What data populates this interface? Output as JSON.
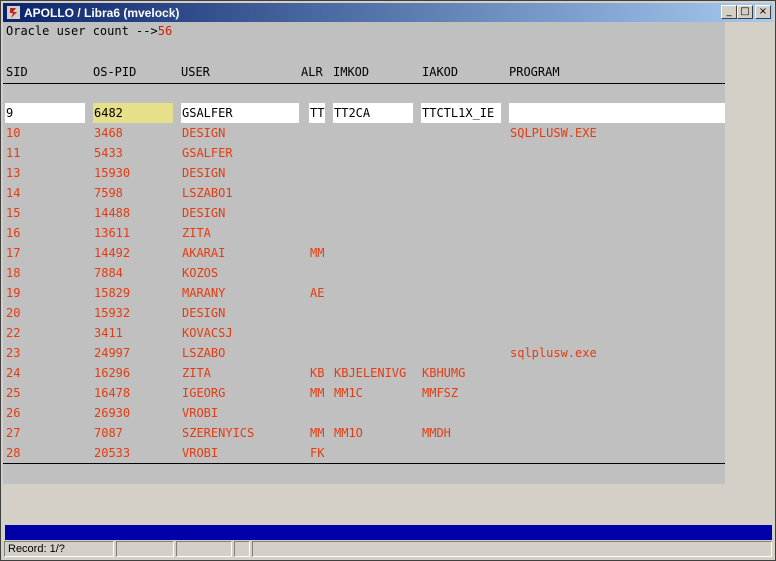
{
  "window": {
    "title": "APOLLO / Libra6 (mvelock)",
    "buttons": {
      "minimize": "_",
      "maximize": "□",
      "close": "×"
    }
  },
  "summary": {
    "label": "Oracle user count -->",
    "value": "56"
  },
  "columns": {
    "sid": "SID",
    "ospid": "OS-PID",
    "user": "USER",
    "alr": "ALR",
    "imkod": "IMKOD",
    "iakod": "IAKOD",
    "program": "PROGRAM"
  },
  "current_row": {
    "sid": "9",
    "ospid": "6482",
    "user": "GSALFER",
    "alr": "TT",
    "imkod": "TT2CA",
    "iakod": "TTCTL1X_IE",
    "program": ""
  },
  "rows": [
    {
      "sid": "10",
      "ospid": "3468",
      "user": "DESIGN",
      "alr": "",
      "imkod": "",
      "iakod": "",
      "program": "SQLPLUSW.EXE"
    },
    {
      "sid": "11",
      "ospid": "5433",
      "user": "GSALFER",
      "alr": "",
      "imkod": "",
      "iakod": "",
      "program": ""
    },
    {
      "sid": "13",
      "ospid": "15930",
      "user": "DESIGN",
      "alr": "",
      "imkod": "",
      "iakod": "",
      "program": ""
    },
    {
      "sid": "14",
      "ospid": "7598",
      "user": "LSZABO1",
      "alr": "",
      "imkod": "",
      "iakod": "",
      "program": ""
    },
    {
      "sid": "15",
      "ospid": "14488",
      "user": "DESIGN",
      "alr": "",
      "imkod": "",
      "iakod": "",
      "program": ""
    },
    {
      "sid": "16",
      "ospid": "13611",
      "user": "ZITA",
      "alr": "",
      "imkod": "",
      "iakod": "",
      "program": ""
    },
    {
      "sid": "17",
      "ospid": "14492",
      "user": "AKARAI",
      "alr": "MM",
      "imkod": "",
      "iakod": "",
      "program": ""
    },
    {
      "sid": "18",
      "ospid": "7884",
      "user": "KOZOS",
      "alr": "",
      "imkod": "",
      "iakod": "",
      "program": ""
    },
    {
      "sid": "19",
      "ospid": "15829",
      "user": "MARANY",
      "alr": "AE",
      "imkod": "",
      "iakod": "",
      "program": ""
    },
    {
      "sid": "20",
      "ospid": "15932",
      "user": "DESIGN",
      "alr": "",
      "imkod": "",
      "iakod": "",
      "program": ""
    },
    {
      "sid": "22",
      "ospid": "3411",
      "user": "KOVACSJ",
      "alr": "",
      "imkod": "",
      "iakod": "",
      "program": ""
    },
    {
      "sid": "23",
      "ospid": "24997",
      "user": "LSZABO",
      "alr": "",
      "imkod": "",
      "iakod": "",
      "program": "sqlplusw.exe"
    },
    {
      "sid": "24",
      "ospid": "16296",
      "user": "ZITA",
      "alr": "KB",
      "imkod": "KBJELENIVG",
      "iakod": "KBHUMG",
      "program": ""
    },
    {
      "sid": "25",
      "ospid": "16478",
      "user": "IGEORG",
      "alr": "MM",
      "imkod": "MM1C",
      "iakod": "MMFSZ",
      "program": ""
    },
    {
      "sid": "26",
      "ospid": "26930",
      "user": "VROBI",
      "alr": "",
      "imkod": "",
      "iakod": "",
      "program": ""
    },
    {
      "sid": "27",
      "ospid": "7087",
      "user": "SZERENYICS",
      "alr": "MM",
      "imkod": "MM1O",
      "iakod": "MMDH",
      "program": ""
    },
    {
      "sid": "28",
      "ospid": "20533",
      "user": "VROBI",
      "alr": "FK",
      "imkod": "",
      "iakod": "",
      "program": ""
    }
  ],
  "statusbar": {
    "record": "Record: 1/?"
  },
  "colors": {
    "text_red": "#e43c10",
    "field_bg": "#ffffff",
    "highlight": "#e6e08a",
    "canvas": "#c0c0c0",
    "status_blue": "#0000a8"
  }
}
